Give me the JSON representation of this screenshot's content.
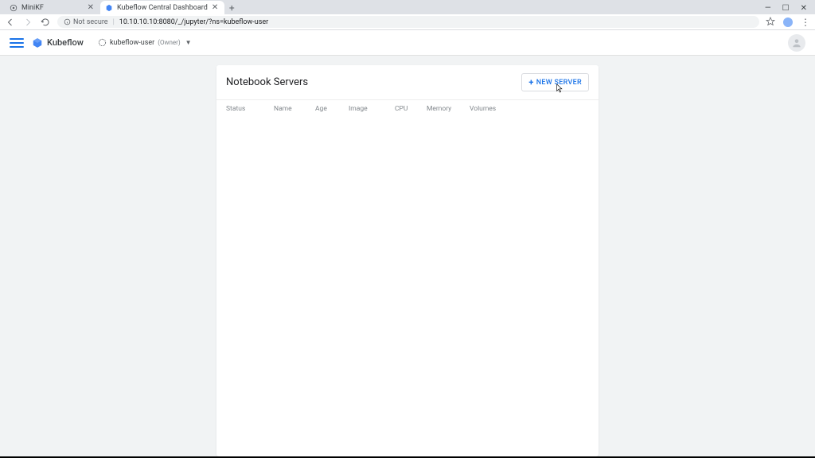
{
  "browser": {
    "tabs": [
      {
        "title": "MiniKF",
        "active": false
      },
      {
        "title": "Kubeflow Central Dashboard",
        "active": true
      }
    ],
    "security_label": "Not secure",
    "url": "10.10.10.10:8080/_/jupyter/?ns=kubeflow-user"
  },
  "header": {
    "brand": "Kubeflow",
    "namespace": "kubeflow-user",
    "namespace_role": "(Owner)"
  },
  "card": {
    "title": "Notebook Servers",
    "new_button": "NEW SERVER",
    "columns": {
      "status": "Status",
      "name": "Name",
      "age": "Age",
      "image": "Image",
      "cpu": "CPU",
      "memory": "Memory",
      "volumes": "Volumes"
    }
  }
}
